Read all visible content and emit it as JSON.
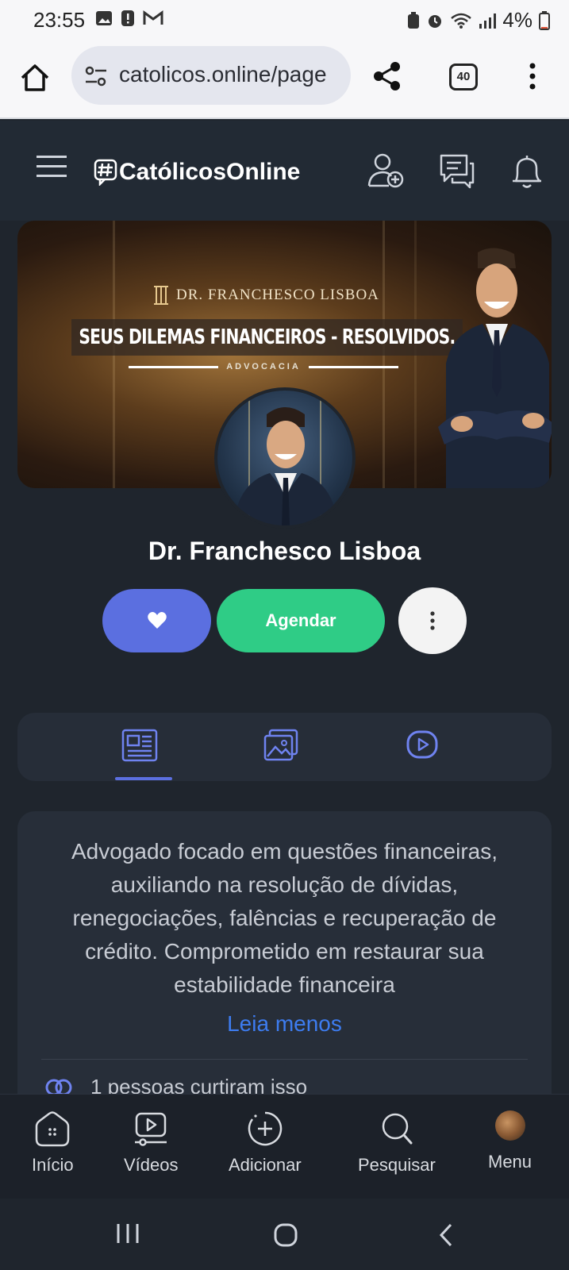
{
  "status_bar": {
    "time": "23:55",
    "battery": "4%"
  },
  "browser": {
    "url": "catolicos.online/page",
    "tab_count": "40"
  },
  "site": {
    "logo_text": "CatólicosOnline"
  },
  "banner": {
    "brand": "DR. FRANCHESCO LISBOA",
    "headline": "SEUS DILEMAS FINANCEIROS - RESOLVIDOS.",
    "subheadline": "ADVOCACIA"
  },
  "profile": {
    "name": "Dr. Franchesco Lisboa",
    "agendar_label": "Agendar"
  },
  "about": {
    "text": "Advogado focado em questões financeiras, auxiliando na resolução de dívidas, renegociações, falências e recuperação de crédito. Comprometido em restaurar sua estabilidade financeira",
    "toggle_label": "Leia menos",
    "likes_text": "1 pessoas curtiram isso"
  },
  "bottom_nav": {
    "inicio": "Início",
    "videos": "Vídeos",
    "adicionar": "Adicionar",
    "pesquisar": "Pesquisar",
    "menu": "Menu"
  },
  "colors": {
    "like_button": "#5b6fe0",
    "agendar_button": "#2fcc86",
    "link": "#3d7cf0",
    "header_bg": "#222a34"
  }
}
